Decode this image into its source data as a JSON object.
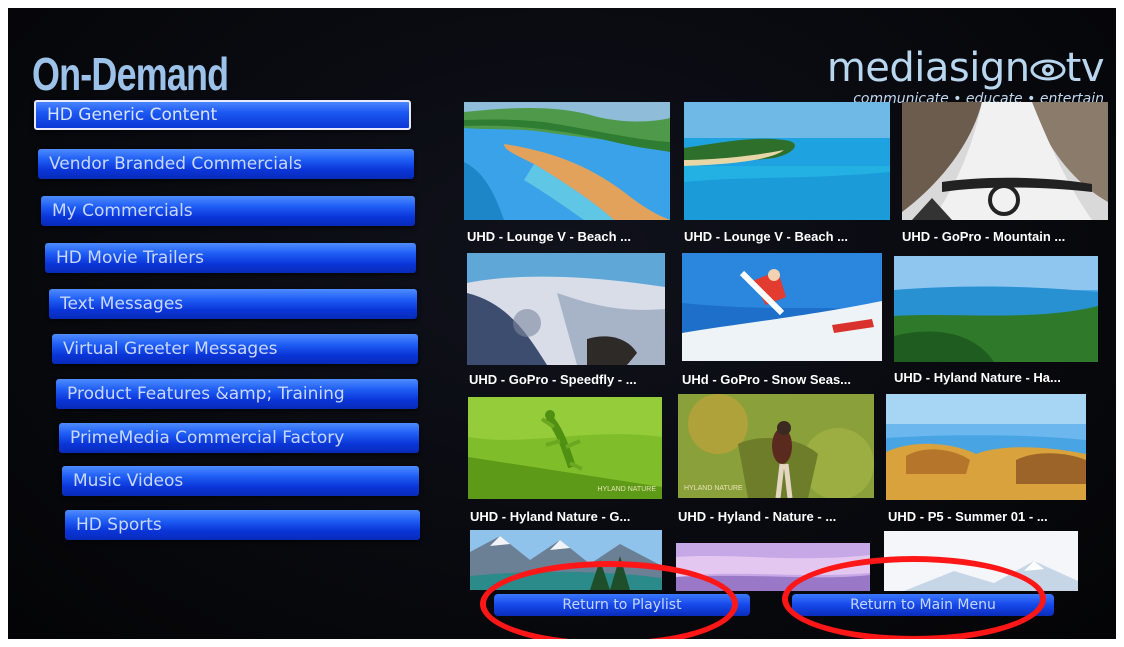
{
  "header": {
    "title": "On-Demand",
    "logo_name": "mediasign",
    "logo_suffix": "tv",
    "logo_tagline": "communicate • educate • entertain"
  },
  "menu": {
    "items": [
      {
        "label": "HD Generic Content",
        "selected": true
      },
      {
        "label": "Vendor Branded Commercials"
      },
      {
        "label": "My Commercials"
      },
      {
        "label": "HD Movie Trailers"
      },
      {
        "label": "Text Messages"
      },
      {
        "label": "Virtual Greeter Messages"
      },
      {
        "label": "Product Features &amp; Training"
      },
      {
        "label": "PrimeMedia Commercial Factory"
      },
      {
        "label": "Music Videos"
      },
      {
        "label": "HD Sports"
      }
    ]
  },
  "videos": {
    "rows": [
      [
        {
          "caption": "UHD - Lounge V - Beach ...",
          "scene": "beach-aerial-image"
        },
        {
          "caption": "UHD - Lounge V - Beach ...",
          "scene": "beach-lagoon-image"
        },
        {
          "caption": "UHD - GoPro - Mountain ...",
          "scene": "mountain-bike-image"
        }
      ],
      [
        {
          "caption": "UHD - GoPro - Speedfly - ...",
          "scene": "speedfly-image"
        },
        {
          "caption": "UHd - GoPro - Snow Seas...",
          "scene": "snowboard-image"
        },
        {
          "caption": "UHD - Hyland Nature - Ha...",
          "scene": "coast-image"
        }
      ],
      [
        {
          "caption": "UHD - Hyland Nature - G...",
          "scene": "gecko-image",
          "watermark": "HYLAND NATURE"
        },
        {
          "caption": "UHD - Hyland - Nature - ...",
          "scene": "bird-image",
          "watermark": "HYLAND NATURE"
        },
        {
          "caption": "UHD - P5 - Summer 01 - ...",
          "scene": "summer-rocks-image"
        }
      ],
      [
        {
          "caption": "",
          "scene": "alpine-lake-image"
        },
        {
          "caption": "",
          "scene": "pastel-sky-image"
        },
        {
          "caption": "",
          "scene": "snowy-peak-image"
        }
      ]
    ]
  },
  "buttons": {
    "return_playlist": "Return to Playlist",
    "return_main_menu": "Return to Main Menu"
  },
  "colors": {
    "menu_blue": "#1f5ef5",
    "title_blue": "#9cc2ea",
    "annotation_red": "#ff1616"
  }
}
